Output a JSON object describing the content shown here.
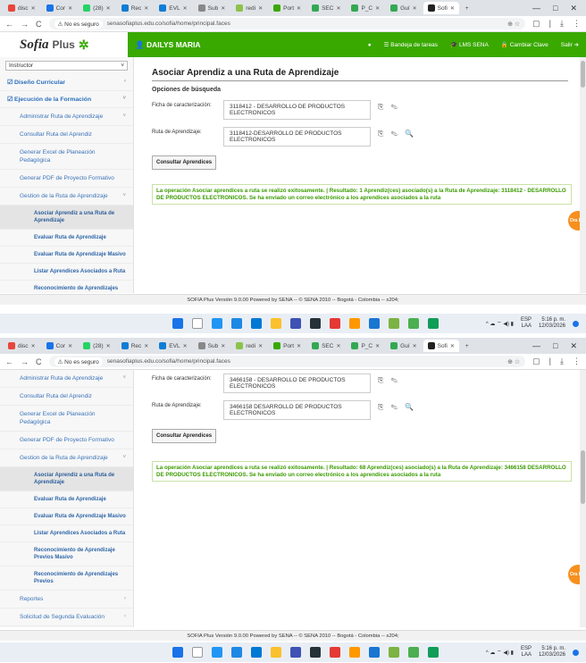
{
  "browser": {
    "tabs": [
      "disc",
      "Cor",
      "(28)",
      "Rec",
      "EVL",
      "Sub",
      "redi",
      "Port",
      "SEC",
      "P_C",
      "Guí",
      "Sofi"
    ],
    "new_tab": "+",
    "window_controls": [
      "—",
      "□",
      "✕"
    ],
    "nav": [
      "←",
      "→",
      "C"
    ],
    "insecure_label": "⚠ No es seguro",
    "url": "senasofiaplus.edu.co/sofia/home/principal.faces",
    "omni_right": "⊕  ☆",
    "toolbar_icons": [
      "▢",
      "|",
      "⤓",
      "⋮"
    ]
  },
  "app": {
    "logo_text": "Sofia",
    "logo_plus": "Plus",
    "logo_mark": "✲",
    "user_name": "👤 DAILYS MARIA",
    "header_links": [
      "●",
      "☰ Bandeja de tareas",
      "🎓 LMS SENA",
      "🔒 Cambiar Clave",
      "Salir ➜"
    ]
  },
  "sidebar": {
    "role_select": "Instructor",
    "items1": [
      {
        "label": "☑ Diseño Curricular",
        "type": "head",
        "chev": "‹"
      },
      {
        "label": "☑ Ejecución de la Formación",
        "type": "head",
        "chev": "˅"
      },
      {
        "label": "Administrar Ruta de Aprendizaje",
        "type": "sub",
        "chev": "˅"
      },
      {
        "label": "Consultar Ruta del Aprendiz",
        "type": "sub",
        "chev": ""
      },
      {
        "label": "Generar Excel de Planeación Pedagógica",
        "type": "sub",
        "chev": ""
      },
      {
        "label": "Generar PDF de Proyecto Formativo",
        "type": "sub",
        "chev": ""
      },
      {
        "label": "Gestion de la Ruta de Aprendizaje",
        "type": "sub",
        "chev": "˅"
      },
      {
        "label": "Asociar Aprendiz a una Ruta de Aprendizaje",
        "type": "sub2 active",
        "chev": ""
      },
      {
        "label": "Evaluar Ruta de Aprendizaje",
        "type": "sub2",
        "chev": ""
      },
      {
        "label": "Evaluar Ruta de Aprendizaje Masivo",
        "type": "sub2",
        "chev": ""
      },
      {
        "label": "Listar Aprendices Asociados a Ruta",
        "type": "sub2",
        "chev": ""
      },
      {
        "label": "Reconocimiento de Aprendizajes",
        "type": "sub2",
        "chev": ""
      }
    ],
    "items2": [
      {
        "label": "Administrar Ruta de Aprendizaje",
        "type": "sub",
        "chev": "˅"
      },
      {
        "label": "Consultar Ruta del Aprendiz",
        "type": "sub",
        "chev": ""
      },
      {
        "label": "Generar Excel de Planeación Pedagógica",
        "type": "sub",
        "chev": ""
      },
      {
        "label": "Generar PDF de Proyecto Formativo",
        "type": "sub",
        "chev": ""
      },
      {
        "label": "Gestion de la Ruta de Aprendizaje",
        "type": "sub",
        "chev": "˅"
      },
      {
        "label": "Asociar Aprendiz a una Ruta de Aprendizaje",
        "type": "sub2 active",
        "chev": ""
      },
      {
        "label": "Evaluar Ruta de Aprendizaje",
        "type": "sub2",
        "chev": ""
      },
      {
        "label": "Evaluar Ruta de Aprendizaje Masivo",
        "type": "sub2",
        "chev": ""
      },
      {
        "label": "Listar Aprendices Asociados a Ruta",
        "type": "sub2",
        "chev": ""
      },
      {
        "label": "Reconocimiento de Aprendizaje Previos Masivo",
        "type": "sub2",
        "chev": ""
      },
      {
        "label": "Reconocimiento de Aprendizajes Previos",
        "type": "sub2",
        "chev": ""
      },
      {
        "label": "Reportes",
        "type": "sub",
        "chev": "‹"
      },
      {
        "label": "Solicitud de Segunda Evaluación",
        "type": "sub",
        "chev": "‹"
      }
    ]
  },
  "form1": {
    "title": "Asociar Aprendiz a una Ruta de Aprendizaje",
    "section": "Opciones de búsqueda",
    "ficha_label": "Ficha de caracterización:",
    "ficha_value": "3118412 - DESARROLLO DE PRODUCTOS ELECTRONICOS",
    "ficha_icons": "⎘ ✎",
    "ruta_label": "Ruta de Aprendizaje:",
    "ruta_value": "3118412-DESARROLLO DE PRODUCTOS ELECTRONICOS",
    "ruta_icons": "⎘ ✎ 🔍",
    "button": "Consultar Aprendices",
    "success": "La operación Asociar aprendices a ruta se realizó exitosamente. | Resultado: 1 Aprendiz(ces) asociado(s) a la Ruta de Aprendizaje: 3118412 - DESARROLLO DE PRODUCTOS ELECTRONICOS. Se ha enviado un correo electrónico a los aprendices asociados a la ruta"
  },
  "form2": {
    "ficha_label": "Ficha de caracterización:",
    "ficha_value": "3466158 - DESARROLLO DE PRODUCTOS ELECTRONICOS",
    "ficha_icons": "⎘ ✎",
    "ruta_label": "Ruta de Aprendizaje:",
    "ruta_value": "3466158 DESARROLLO DE PRODUCTOS ELECTRONICOS",
    "ruta_icons": "⎘ ✎ 🔍",
    "button": "Consultar Aprendices",
    "success": "La operación Asociar aprendices a ruta se realizó exitosamente. | Resultado: 68 Aprendiz(ces) asociado(s) a la Ruta de Aprendizaje: 3466158 DESARROLLO DE PRODUCTOS ELECTRONICOS. Se ha enviado un correo electrónico a los aprendices asociados a la ruta"
  },
  "footer": "SOFIA Plus Versión 9.0.00 Powered by SENA -- © SENA 2010 -- Bogotá - Colombia -- s204;",
  "chatbot": "Ora Bot",
  "taskbar": {
    "lang1": "ESP",
    "lang2": "LAA",
    "time1": "5:16 p. m.",
    "date1": "12/03/2026",
    "time2": "5:16 p. m.",
    "date2": "12/03/2026",
    "tray_icons": "^ ☁  ⌔ ◀) ▮"
  },
  "colors": {
    "sena_green": "#39a900",
    "link_blue": "#2a6ebb",
    "chatbot_orange": "#f7901e"
  }
}
